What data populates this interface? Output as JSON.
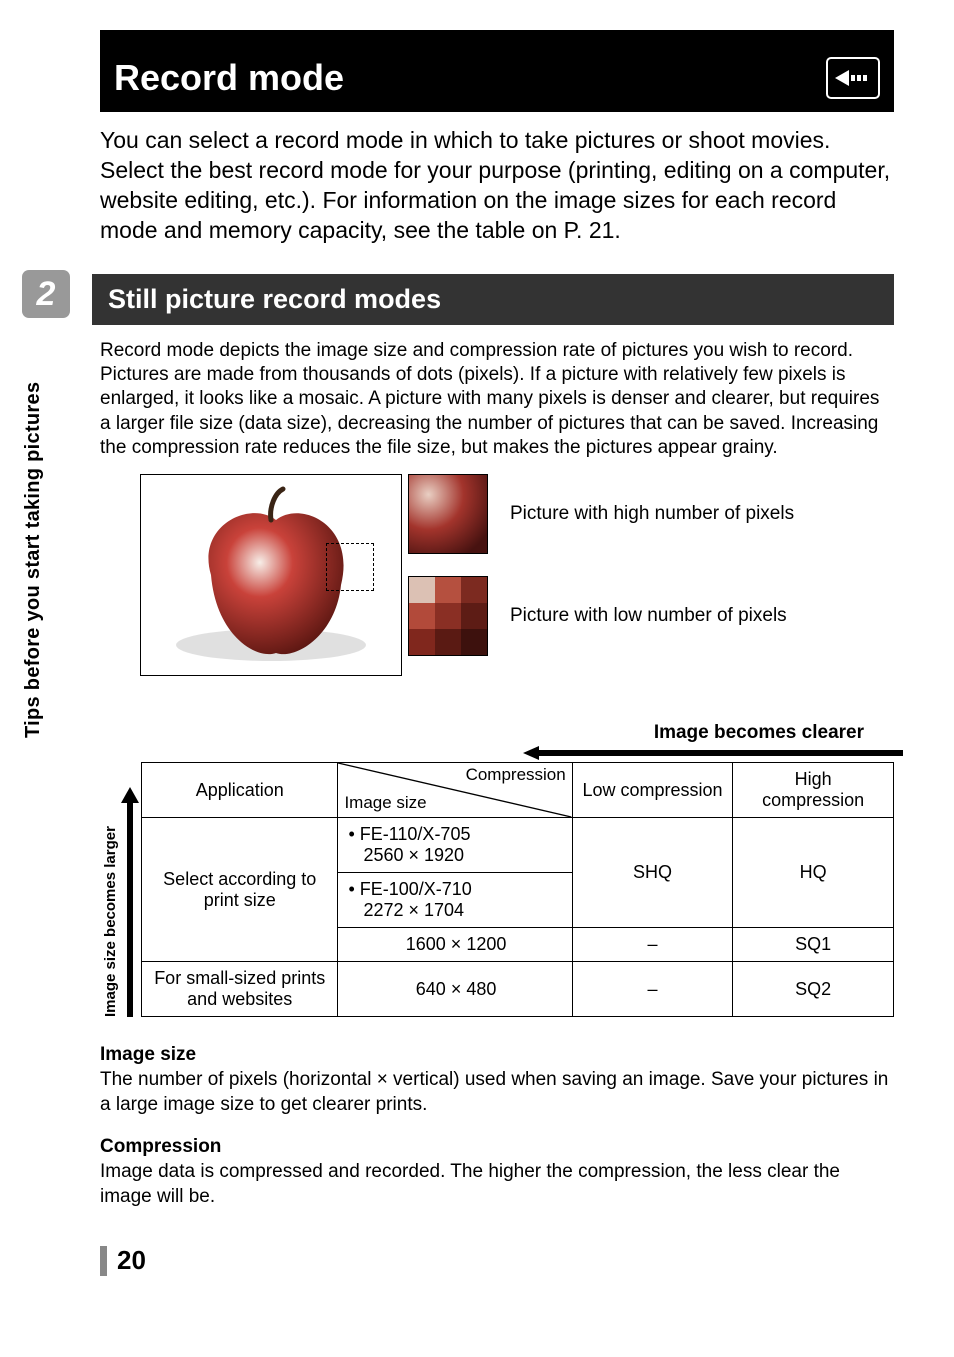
{
  "chapter": {
    "number": "2",
    "side_label": "Tips before you start taking pictures"
  },
  "title": "Record mode",
  "intro": "You can select a record mode in which to take pictures or shoot movies. Select the best record mode for your purpose (printing, editing on a computer, website editing, etc.). For information on the image sizes for each record mode and memory capacity, see the table on P. 21.",
  "section": "Still picture record modes",
  "body": "Record mode depicts the image size and compression rate of pictures you wish to record.\nPictures are made from thousands of dots (pixels). If a picture with relatively few pixels is enlarged, it looks like a mosaic. A picture with many pixels is denser and clearer, but requires a larger file size (data size), decreasing the number of pictures that can be saved. Increasing the compression rate reduces the file size, but makes the pictures appear grainy.",
  "imgcaps": {
    "hi": "Picture with high number of pixels",
    "lo": "Picture with low number of pixels"
  },
  "table": {
    "h_label": "Image becomes clearer",
    "v_label": "Image size becomes larger",
    "head": {
      "app": "Application",
      "diag_top": "Compression",
      "diag_bot": "Image size",
      "low": "Low compression",
      "high": "High compression"
    },
    "rows": {
      "print_app": "Select according to print size",
      "r1_size": "• FE-110/X-705\n   2560 × 1920",
      "r2_size": "• FE-100/X-710\n   2272 × 1704",
      "r12_low": "SHQ",
      "r12_high": "HQ",
      "r3_size": "1600 × 1200",
      "r3_low": "–",
      "r3_high": "SQ1",
      "r4_app": "For small-sized prints and websites",
      "r4_size": "640 × 480",
      "r4_low": "–",
      "r4_high": "SQ2"
    }
  },
  "imgsize": {
    "hd": "Image size",
    "txt": "The number of pixels (horizontal × vertical) used when saving an image. Save your pictures in a large image size to get clearer prints."
  },
  "compression": {
    "hd": "Compression",
    "txt": "Image data is compressed and recorded. The higher the compression, the less clear the image will be."
  },
  "page": "20"
}
